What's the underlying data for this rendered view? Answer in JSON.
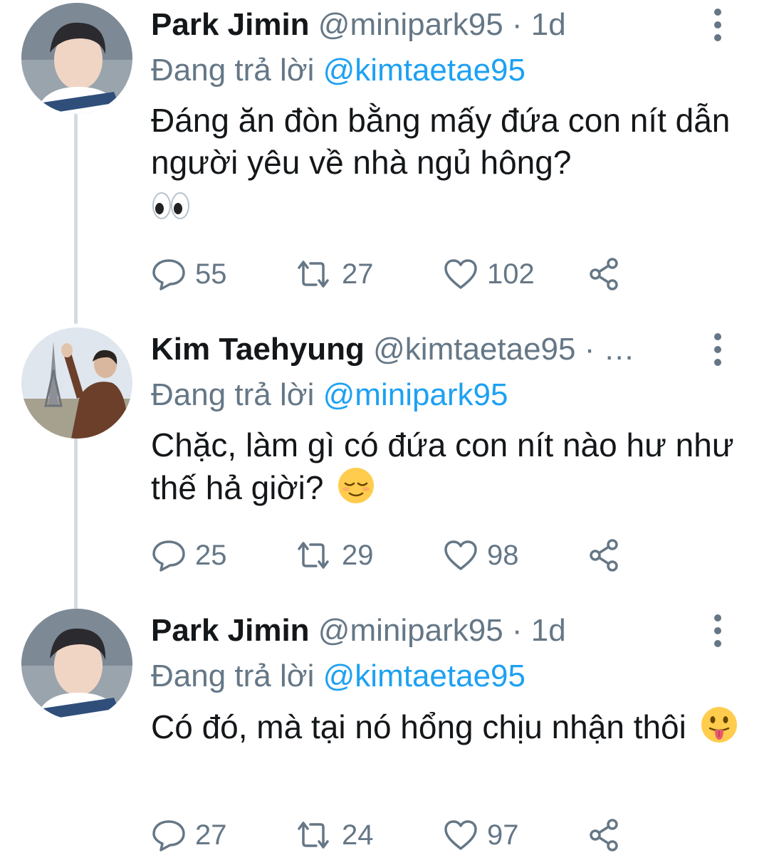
{
  "tweets": [
    {
      "name": "Park Jimin",
      "handle": "@minipark95",
      "dot": "·",
      "time": "1d",
      "reply_prefix": "Đang trả lời",
      "reply_to": "@kimtaetae95",
      "text": "Đáng ăn đòn bằng mấy đứa con nít dẫn người yêu về nhà ngủ hông?",
      "emoji": "eyes-emoji",
      "replies": "55",
      "retweets": "27",
      "likes": "102"
    },
    {
      "name": "Kim Taehyung",
      "handle": "@kimtaetae95",
      "dot": "·",
      "time": "…",
      "reply_prefix": "Đang trả lời",
      "reply_to": "@minipark95",
      "text": "Chặc, làm gì có đứa con nít nào hư như thế hả giời?",
      "emoji": "relieved-face-emoji",
      "replies": "25",
      "retweets": "29",
      "likes": "98"
    },
    {
      "name": "Park Jimin",
      "handle": "@minipark95",
      "dot": "·",
      "time": "1d",
      "reply_prefix": "Đang trả lời",
      "reply_to": "@kimtaetae95",
      "text": "Có đó, mà tại nó hổng chịu nhận thôi",
      "emoji": "tongue-face-emoji",
      "replies": "27",
      "retweets": "24",
      "likes": "97"
    }
  ],
  "colors": {
    "text": "#14171a",
    "secondary": "#657786",
    "link": "#1da1f2",
    "thread_line": "#d3dbe1"
  },
  "icons": [
    "reply-icon",
    "retweet-icon",
    "like-icon",
    "share-icon",
    "more-options-icon"
  ]
}
